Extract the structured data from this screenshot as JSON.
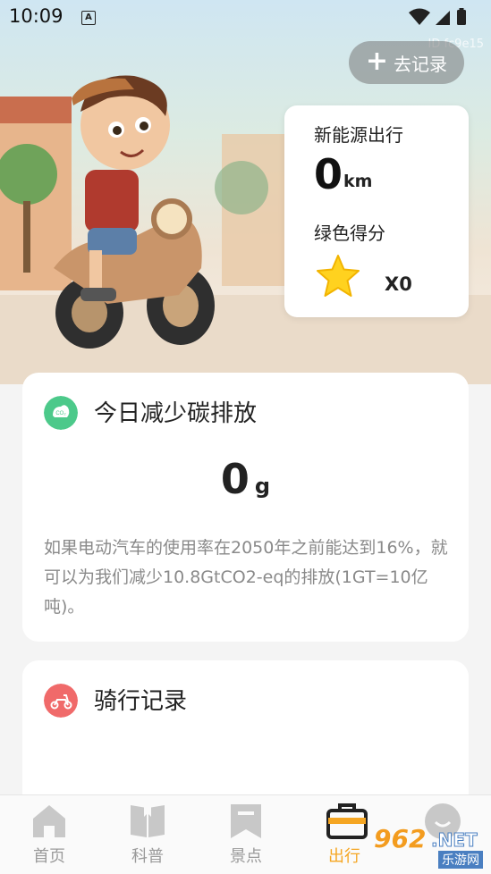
{
  "status_bar": {
    "time": "10:09",
    "notif_letter": "A"
  },
  "id_label": "ID fc9e15",
  "header": {
    "record_button_label": "去记录"
  },
  "stats_card": {
    "distance_label": "新能源出行",
    "distance_value": "0",
    "distance_unit": "km",
    "score_label": "绿色得分",
    "score_value": "X0"
  },
  "carbon_card": {
    "title": "今日减少碳排放",
    "value": "0",
    "unit": "g",
    "description": "如果电动汽车的使用率在2050年之前能达到16%，就可以为我们减少10.8GtCO2-eq的排放(1GT=10亿吨)。",
    "icon_text": "CO₂"
  },
  "ride_card": {
    "title": "骑行记录"
  },
  "tabbar": {
    "items": [
      {
        "label": "首页",
        "icon": "home-icon"
      },
      {
        "label": "科普",
        "icon": "book-icon"
      },
      {
        "label": "景点",
        "icon": "bookmark-icon"
      },
      {
        "label": "出行",
        "icon": "briefcase-icon",
        "active": true
      },
      {
        "label": "",
        "icon": "profile-icon"
      }
    ]
  },
  "watermark": {
    "brand": "962",
    "suffix": ".NET",
    "sub": "乐游网"
  },
  "colors": {
    "accent": "#f5a623",
    "green": "#4cc98a",
    "red": "#f06a6a"
  }
}
